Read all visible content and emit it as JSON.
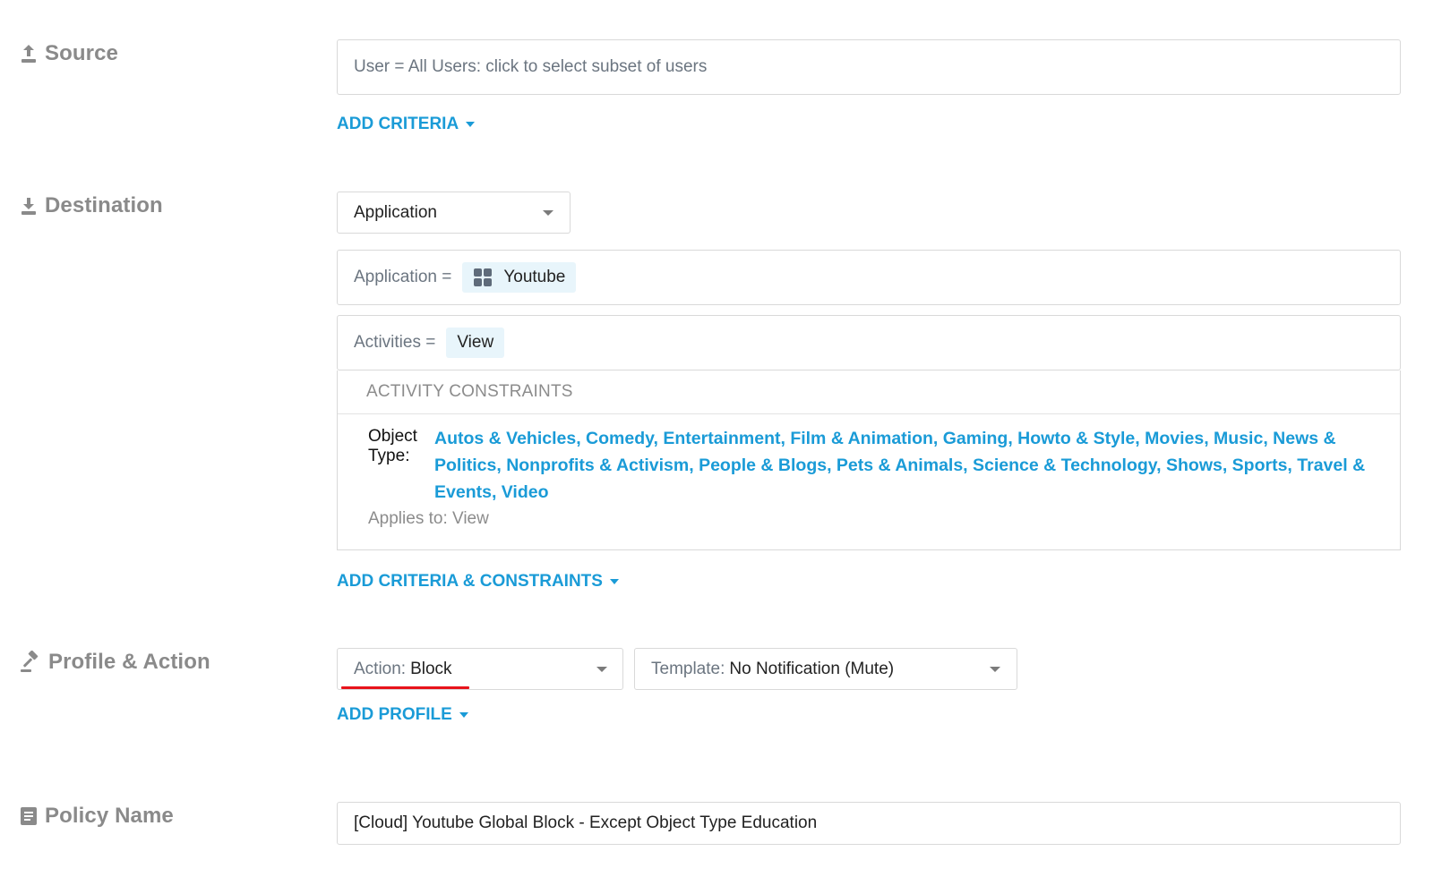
{
  "source": {
    "label": "Source",
    "user_field": "User = All Users: click to select subset of users",
    "add_criteria": "ADD CRITERIA"
  },
  "destination": {
    "label": "Destination",
    "type_select": "Application",
    "application_prefix": "Application =",
    "application_value": "Youtube",
    "activities_prefix": "Activities =",
    "activities_value": "View",
    "constraints_header": "ACTIVITY CONSTRAINTS",
    "object_type_key": "Object Type:",
    "object_type_values": "Autos & Vehicles, Comedy, Entertainment, Film & Animation, Gaming, Howto & Style, Movies, Music, News & Politics, Nonprofits & Activism, People & Blogs, Pets & Animals, Science & Technology, Shows, Sports, Travel & Events, Video",
    "applies_to": "Applies to: View",
    "add_criteria_constraints": "ADD CRITERIA & CONSTRAINTS"
  },
  "profile_action": {
    "label": "Profile & Action",
    "action_prefix": "Action:",
    "action_value": "Block",
    "template_prefix": "Template:",
    "template_value": "No Notification (Mute)",
    "add_profile": "ADD PROFILE"
  },
  "policy": {
    "label": "Policy Name",
    "name_value": "[Cloud] Youtube Global Block - Except Object Type Education"
  },
  "colors": {
    "link": "#1a9bd7",
    "chip_bg": "#e8f5fb",
    "underline": "#e8131b",
    "label_gray": "#8a8a8a"
  }
}
